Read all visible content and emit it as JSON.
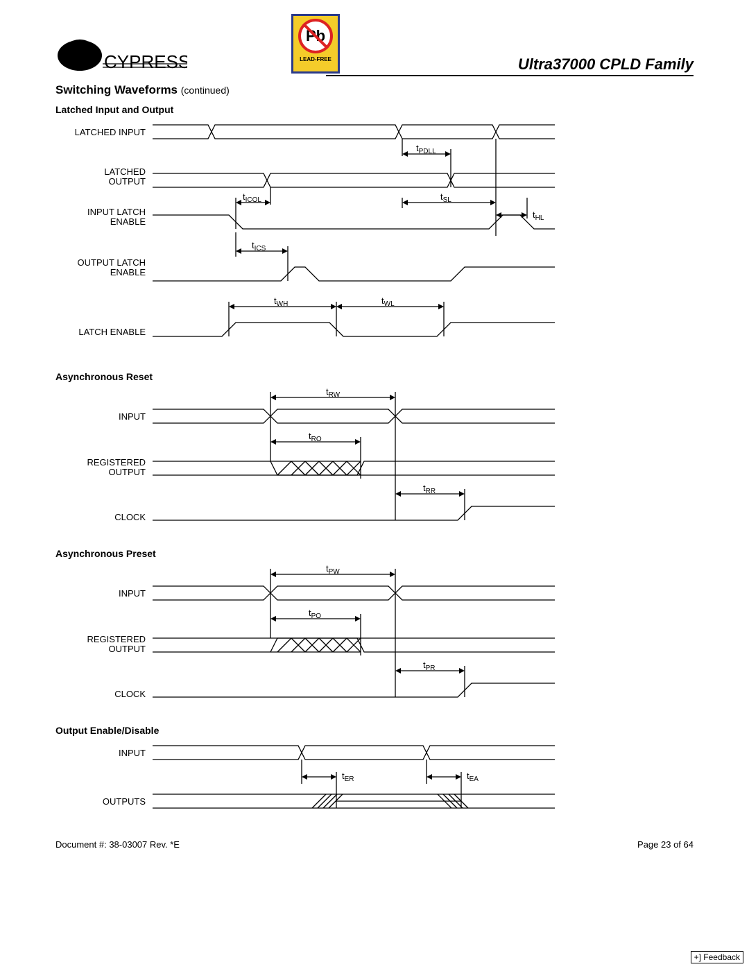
{
  "header": {
    "company": "CYPRESS",
    "badge_symbol": "Pb",
    "badge_text": "LEAD-FREE",
    "title": "Ultra37000 CPLD Family"
  },
  "section": {
    "title": "Switching Waveforms",
    "continued": "(continued)"
  },
  "diagrams": {
    "latched": {
      "title": "Latched Input and Output",
      "signals": {
        "latched_input": "LATCHED INPUT",
        "latched_output_l1": "LATCHED",
        "latched_output_l2": "OUTPUT",
        "input_latch_l1": "INPUT LATCH",
        "input_latch_l2": "ENABLE",
        "output_latch_l1": "OUTPUT LATCH",
        "output_latch_l2": "ENABLE",
        "latch_enable": "LATCH ENABLE"
      },
      "timings": {
        "tPDLL": "PDLL",
        "tICOL": "ICOL",
        "tSL": "SL",
        "tHL": "HL",
        "tICS": "ICS",
        "tWH": "WH",
        "tWL": "WL"
      }
    },
    "async_reset": {
      "title": "Asynchronous Reset",
      "signals": {
        "input": "INPUT",
        "reg_out_l1": "REGISTERED",
        "reg_out_l2": "OUTPUT",
        "clock": "CLOCK"
      },
      "timings": {
        "tRW": "RW",
        "tRO": "RO",
        "tRR": "RR"
      }
    },
    "async_preset": {
      "title": "Asynchronous Preset",
      "signals": {
        "input": "INPUT",
        "reg_out_l1": "REGISTERED",
        "reg_out_l2": "OUTPUT",
        "clock": "CLOCK"
      },
      "timings": {
        "tPW": "PW",
        "tPO": "PO",
        "tPR": "PR"
      }
    },
    "output_enable": {
      "title": "Output Enable/Disable",
      "signals": {
        "input": "INPUT",
        "outputs": "OUTPUTS"
      },
      "timings": {
        "tER": "ER",
        "tEA": "EA"
      }
    }
  },
  "footer": {
    "docnum": "Document #: 38-03007  Rev. *E",
    "page": "Page 23 of 64",
    "feedback": "+] Feedback"
  }
}
